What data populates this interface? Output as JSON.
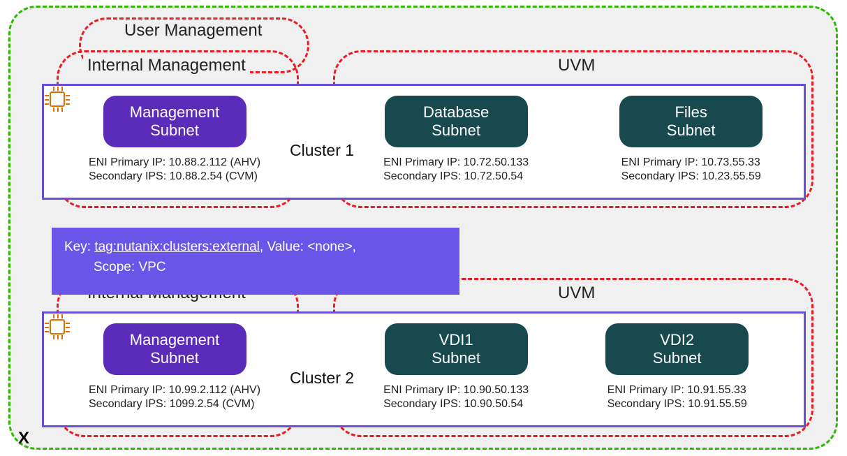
{
  "zones": {
    "user_management": "User Management",
    "internal_management": "Internal Management",
    "internal_management_2": "Internal Management",
    "uvm_1": "UVM",
    "uvm_2": "UVM"
  },
  "tag_callout": {
    "line1_pre": "Key: ",
    "key": "tag:nutanix:clusters:external",
    "line1_mid": ", Value: ",
    "value": "<none>",
    "line1_post": ",",
    "scope_pre": "Scope: ",
    "scope": "VPC"
  },
  "clusters": [
    {
      "title": "Cluster 1",
      "management": {
        "label": "Management\nSubnet",
        "primary": "ENI Primary IP: 10.88.2.112 (AHV)",
        "secondary": "Secondary IPS: 10.88.2.54 (CVM)"
      },
      "subnetA": {
        "label": "Database\nSubnet",
        "primary": "ENI Primary IP: 10.72.50.133",
        "secondary": "Secondary IPS: 10.72.50.54"
      },
      "subnetB": {
        "label": "Files\nSubnet",
        "primary": "ENI Primary IP: 10.73.55.33",
        "secondary": "Secondary IPS: 10.23.55.59"
      }
    },
    {
      "title": "Cluster 2",
      "management": {
        "label": "Management\nSubnet",
        "primary": "ENI Primary IP: 10.99.2.112 (AHV)",
        "secondary": "Secondary IPS: 1099.2.54 (CVM)"
      },
      "subnetA": {
        "label": "VDI1\nSubnet",
        "primary": "ENI Primary IP: 10.90.50.133",
        "secondary": "Secondary IPS: 10.90.50.54"
      },
      "subnetB": {
        "label": "VDI2\nSubnet",
        "primary": "ENI Primary IP: 10.91.55.33",
        "secondary": "Secondary IPS: 10.91.55.59"
      }
    }
  ],
  "x_mark": "X"
}
